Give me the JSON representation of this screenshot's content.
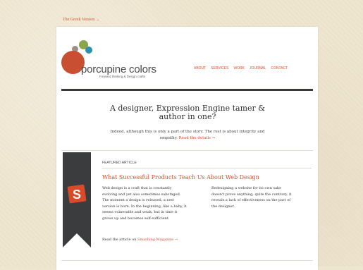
{
  "top_link": "The Greek Version →",
  "logo": {
    "title": "porcupine colors",
    "tagline": "Forward thinking & Design crafts"
  },
  "nav": [
    "ABOUT",
    "SERVICES",
    "WORK",
    "JOURNAL",
    "CONTACT"
  ],
  "hero": {
    "headline": "A designer, Expression Engine tamer & author in one?",
    "intro": "Indeed, although this is only a part of the story. The rest is about integrity and empathy.",
    "details_link": "Read the details →"
  },
  "featured": {
    "label": "FEATURED ARTICLE",
    "title": "What Successful Products Teach Us About Web Design",
    "col_left": "Web design is a craft that is constantly evolving and yet also sometimes sabotaged. The moment a design is released, a new version is born. In the beginning, like a baby, it seems vulnerable and weak, but in time it grows up and becomes self-sufficient.",
    "col_right": "Redesigning a website for its own sake doesn't prove anything; quite the contrary, it reveals a lack of effectiveness on the part of the designer.",
    "read_on_prefix": "Read the article on",
    "read_on_link": "Smashing Magazine →",
    "ribbon_letter": "S"
  },
  "colors": {
    "accent": "#d0502f",
    "dark_rule": "#3b3a35",
    "ribbon": "#3a3c3e",
    "badge": "#d84a2a"
  }
}
